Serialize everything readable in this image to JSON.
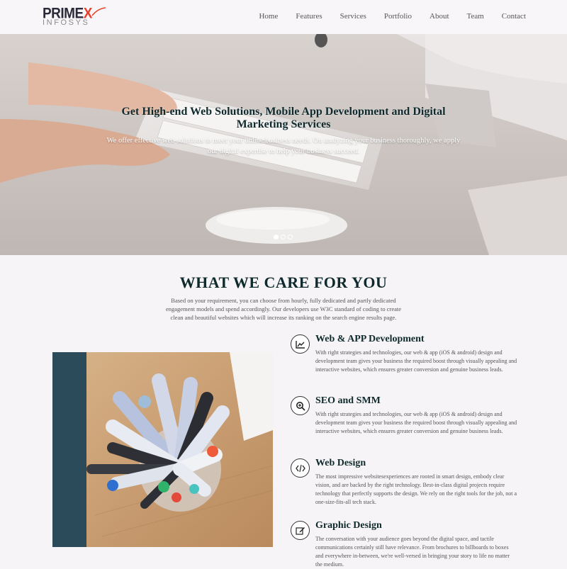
{
  "header": {
    "logo": {
      "brand_main": "PRIME",
      "brand_x": "X",
      "brand_sub": "INFOSYS"
    },
    "nav": [
      "Home",
      "Features",
      "Services",
      "Portfolio",
      "About",
      "Team",
      "Contact"
    ]
  },
  "hero": {
    "title": "Get High-end Web Solutions, Mobile App Development and Digital Marketing Services",
    "subtitle": "We offer effective web solutions to meet your online business needs. On analyzing your business thoroughly, we apply our digital expertise to help your business succeed.",
    "slides": 3,
    "active_slide": 1
  },
  "care": {
    "title": "WHAT WE CARE FOR YOU",
    "intro": "Based on your requirement, you can choose from hourly, fully dedicated and partly dedicated engagement models and spend accordingly. Our developers use W3C standard of coding to create clean and beautiful websites which will increase its ranking on the search engine results page."
  },
  "services": [
    {
      "icon": "chart-line-icon",
      "title": "Web & APP Development",
      "desc": "With right strategies and technologies, our web & app (iOS & android) design and development team gives your business the required boost through visually appealing and interactive websites, which ensures greater conversion and genuine business leads."
    },
    {
      "icon": "search-zoom-icon",
      "title": "SEO and SMM",
      "desc": "With right strategies and technologies, our web & app (iOS & android) design and development team gives your business the required boost through visually appealing and interactive websites, which ensures greater conversion and genuine business leads."
    },
    {
      "icon": "code-icon",
      "title": "Web Design",
      "desc": "The most impressive websitesexperiences are rooted in smart design, embody clear vision, and are backed by the right technology. Best-in-class digital projects require technology that perfectly supports the design. We rely on the right tools for the job, not a one-size-fits-all tech stack."
    },
    {
      "icon": "edit-icon",
      "title": "Graphic Design",
      "desc": "The conversation with your audience goes beyond the digital space, and tactile communications certainly still have relevance. From brochures to billboards to boxes and everywhere in-between, we're well-versed in bringing your story to life no matter the medium."
    }
  ],
  "colors": {
    "accent": "#e9402a",
    "heading": "#0f2a2d",
    "background": "#f6f4f6"
  }
}
